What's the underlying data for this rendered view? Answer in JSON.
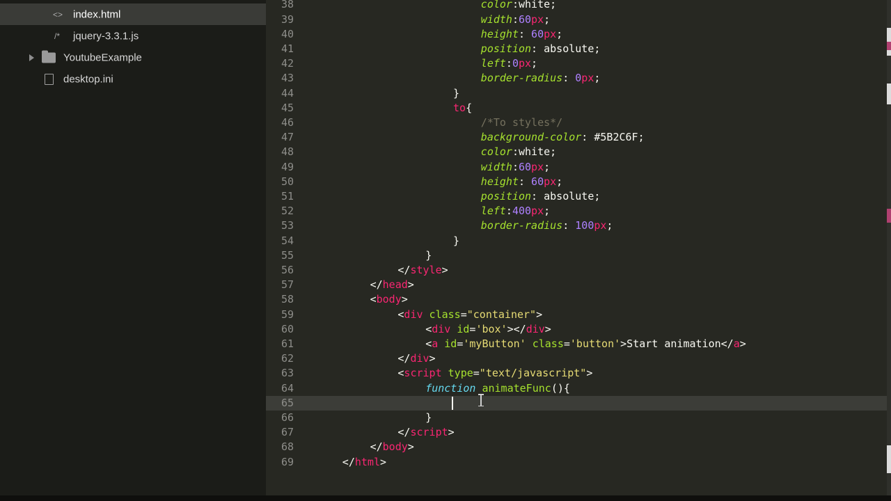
{
  "sidebar": {
    "items": [
      {
        "label": "index.html",
        "icon": "code-file-icon",
        "active": true
      },
      {
        "label": "jquery-3.3.1.js",
        "icon": "comment-file-icon",
        "active": false
      },
      {
        "label": "YoutubeExample",
        "icon": "folder-icon",
        "active": false
      },
      {
        "label": "desktop.ini",
        "icon": "file-icon",
        "active": false
      }
    ],
    "icon_glyphs": {
      "code": "<>",
      "comment": "/*"
    }
  },
  "editor": {
    "current_line": "65",
    "lines": [
      {
        "n": "38",
        "indent": 24,
        "tokens": [
          [
            "color",
            "prop"
          ],
          [
            ":",
            "plain"
          ],
          [
            "white",
            "plain"
          ],
          [
            ";",
            "plain"
          ]
        ]
      },
      {
        "n": "39",
        "indent": 24,
        "tokens": [
          [
            "width",
            "prop"
          ],
          [
            ":",
            "plain"
          ],
          [
            "60",
            "num"
          ],
          [
            "px",
            "unit"
          ],
          [
            ";",
            "plain"
          ]
        ]
      },
      {
        "n": "40",
        "indent": 24,
        "tokens": [
          [
            "height",
            "prop"
          ],
          [
            ": ",
            "plain"
          ],
          [
            "60",
            "num"
          ],
          [
            "px",
            "unit"
          ],
          [
            ";",
            "plain"
          ]
        ]
      },
      {
        "n": "41",
        "indent": 24,
        "tokens": [
          [
            "position",
            "prop"
          ],
          [
            ": ",
            "plain"
          ],
          [
            "absolute",
            "plain"
          ],
          [
            ";",
            "plain"
          ]
        ]
      },
      {
        "n": "42",
        "indent": 24,
        "tokens": [
          [
            "left",
            "prop"
          ],
          [
            ":",
            "plain"
          ],
          [
            "0",
            "num"
          ],
          [
            "px",
            "unit"
          ],
          [
            ";",
            "plain"
          ]
        ]
      },
      {
        "n": "43",
        "indent": 24,
        "tokens": [
          [
            "border-radius",
            "prop"
          ],
          [
            ": ",
            "plain"
          ],
          [
            "0",
            "num"
          ],
          [
            "px",
            "unit"
          ],
          [
            ";",
            "plain"
          ]
        ]
      },
      {
        "n": "44",
        "indent": 20,
        "tokens": [
          [
            "}",
            "plain"
          ]
        ]
      },
      {
        "n": "45",
        "indent": 20,
        "tokens": [
          [
            "to",
            "sel"
          ],
          [
            "{",
            "plain"
          ]
        ]
      },
      {
        "n": "46",
        "indent": 24,
        "tokens": [
          [
            "/*To styles*/",
            "comment"
          ]
        ]
      },
      {
        "n": "47",
        "indent": 24,
        "tokens": [
          [
            "background-color",
            "prop"
          ],
          [
            ": ",
            "plain"
          ],
          [
            "#5B2C6F",
            "plain"
          ],
          [
            ";",
            "plain"
          ]
        ]
      },
      {
        "n": "48",
        "indent": 24,
        "tokens": [
          [
            "color",
            "prop"
          ],
          [
            ":",
            "plain"
          ],
          [
            "white",
            "plain"
          ],
          [
            ";",
            "plain"
          ]
        ]
      },
      {
        "n": "49",
        "indent": 24,
        "tokens": [
          [
            "width",
            "prop"
          ],
          [
            ":",
            "plain"
          ],
          [
            "60",
            "num"
          ],
          [
            "px",
            "unit"
          ],
          [
            ";",
            "plain"
          ]
        ]
      },
      {
        "n": "50",
        "indent": 24,
        "tokens": [
          [
            "height",
            "prop"
          ],
          [
            ": ",
            "plain"
          ],
          [
            "60",
            "num"
          ],
          [
            "px",
            "unit"
          ],
          [
            ";",
            "plain"
          ]
        ]
      },
      {
        "n": "51",
        "indent": 24,
        "tokens": [
          [
            "position",
            "prop"
          ],
          [
            ": ",
            "plain"
          ],
          [
            "absolute",
            "plain"
          ],
          [
            ";",
            "plain"
          ]
        ]
      },
      {
        "n": "52",
        "indent": 24,
        "tokens": [
          [
            "left",
            "prop"
          ],
          [
            ":",
            "plain"
          ],
          [
            "400",
            "num"
          ],
          [
            "px",
            "unit"
          ],
          [
            ";",
            "plain"
          ]
        ]
      },
      {
        "n": "53",
        "indent": 24,
        "tokens": [
          [
            "border-radius",
            "prop"
          ],
          [
            ": ",
            "plain"
          ],
          [
            "100",
            "num"
          ],
          [
            "px",
            "unit"
          ],
          [
            ";",
            "plain"
          ]
        ]
      },
      {
        "n": "54",
        "indent": 20,
        "tokens": [
          [
            "}",
            "plain"
          ]
        ]
      },
      {
        "n": "55",
        "indent": 16,
        "tokens": [
          [
            "}",
            "plain"
          ]
        ]
      },
      {
        "n": "56",
        "indent": 12,
        "tokens": [
          [
            "</",
            "plain"
          ],
          [
            "style",
            "tag"
          ],
          [
            ">",
            "plain"
          ]
        ]
      },
      {
        "n": "57",
        "indent": 8,
        "tokens": [
          [
            "</",
            "plain"
          ],
          [
            "head",
            "tag"
          ],
          [
            ">",
            "plain"
          ]
        ]
      },
      {
        "n": "58",
        "indent": 8,
        "tokens": [
          [
            "<",
            "plain"
          ],
          [
            "body",
            "tag"
          ],
          [
            ">",
            "plain"
          ]
        ]
      },
      {
        "n": "59",
        "indent": 12,
        "tokens": [
          [
            "<",
            "plain"
          ],
          [
            "div",
            "tag"
          ],
          [
            " ",
            "plain"
          ],
          [
            "class",
            "attr"
          ],
          [
            "=",
            "plain"
          ],
          [
            "\"container\"",
            "str"
          ],
          [
            ">",
            "plain"
          ]
        ]
      },
      {
        "n": "60",
        "indent": 16,
        "tokens": [
          [
            "<",
            "plain"
          ],
          [
            "div",
            "tag"
          ],
          [
            " ",
            "plain"
          ],
          [
            "id",
            "attr"
          ],
          [
            "=",
            "plain"
          ],
          [
            "'box'",
            "str"
          ],
          [
            "></",
            "plain"
          ],
          [
            "div",
            "tag"
          ],
          [
            ">",
            "plain"
          ]
        ]
      },
      {
        "n": "61",
        "indent": 16,
        "tokens": [
          [
            "<",
            "plain"
          ],
          [
            "a",
            "tag"
          ],
          [
            " ",
            "plain"
          ],
          [
            "id",
            "attr"
          ],
          [
            "=",
            "plain"
          ],
          [
            "'myButton'",
            "str"
          ],
          [
            " ",
            "plain"
          ],
          [
            "class",
            "attr"
          ],
          [
            "=",
            "plain"
          ],
          [
            "'button'",
            "str"
          ],
          [
            ">Start animation</",
            "plain"
          ],
          [
            "a",
            "tag"
          ],
          [
            ">",
            "plain"
          ]
        ]
      },
      {
        "n": "62",
        "indent": 12,
        "tokens": [
          [
            "</",
            "plain"
          ],
          [
            "div",
            "tag"
          ],
          [
            ">",
            "plain"
          ]
        ]
      },
      {
        "n": "63",
        "indent": 12,
        "tokens": [
          [
            "<",
            "plain"
          ],
          [
            "script",
            "tag"
          ],
          [
            " ",
            "plain"
          ],
          [
            "type",
            "attr"
          ],
          [
            "=",
            "plain"
          ],
          [
            "\"text/javascript\"",
            "str"
          ],
          [
            ">",
            "plain"
          ]
        ]
      },
      {
        "n": "64",
        "indent": 16,
        "tokens": [
          [
            "function",
            "kw"
          ],
          [
            " ",
            "plain"
          ],
          [
            "animateFunc",
            "fn"
          ],
          [
            "(){",
            "plain"
          ]
        ]
      },
      {
        "n": "65",
        "indent": 20,
        "tokens": []
      },
      {
        "n": "66",
        "indent": 16,
        "tokens": [
          [
            "}",
            "plain"
          ]
        ]
      },
      {
        "n": "67",
        "indent": 12,
        "tokens": [
          [
            "</",
            "plain"
          ],
          [
            "script",
            "tag"
          ],
          [
            ">",
            "plain"
          ]
        ]
      },
      {
        "n": "68",
        "indent": 8,
        "tokens": [
          [
            "</",
            "plain"
          ],
          [
            "body",
            "tag"
          ],
          [
            ">",
            "plain"
          ]
        ]
      },
      {
        "n": "69",
        "indent": 4,
        "tokens": [
          [
            "</",
            "plain"
          ],
          [
            "html",
            "tag"
          ],
          [
            ">",
            "plain"
          ]
        ]
      }
    ]
  },
  "colors": {
    "background": "#272822",
    "sidebar": "#1b1c18",
    "tag": "#f92672",
    "attribute": "#a6e22e",
    "string": "#e6db74",
    "number": "#ae81ff",
    "comment": "#75715e",
    "keyword": "#66d9ef"
  }
}
